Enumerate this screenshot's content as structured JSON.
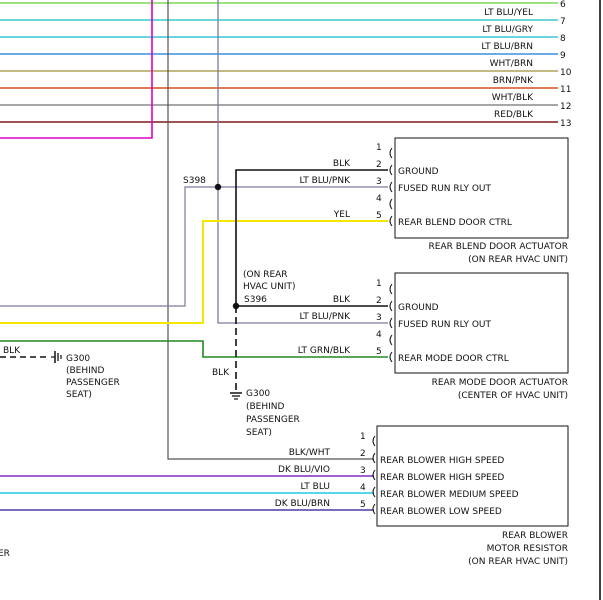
{
  "top_wires": [
    {
      "label": "LT BLU/YEL",
      "pin": "6",
      "color": "#7ed957"
    },
    {
      "label": "LT BLU/GRY",
      "pin": "7",
      "color": "#3dc9c9"
    },
    {
      "label": "LT BLU/BRN",
      "pin": "8",
      "color": "#3cc6d6"
    },
    {
      "label": "WHT/BRN",
      "pin": "9",
      "color": "#3a8fe0"
    },
    {
      "label": "BRN/PNK",
      "pin": "10",
      "color": "#b2a25a"
    },
    {
      "label": "WHT/BLK",
      "pin": "11",
      "color": "#d94f1e"
    },
    {
      "label": "RED/BLK",
      "pin": "12",
      "color": "#8a8a8a"
    },
    {
      "label": "",
      "pin": "13",
      "color": "#7a1a1a"
    }
  ],
  "splices": {
    "s398": "S398",
    "s396": "S396",
    "s396_note_line1": "(ON REAR",
    "s396_note_line2": "HVAC UNIT)"
  },
  "actuator1": {
    "pins": [
      {
        "num": "1",
        "wire": "",
        "func": ""
      },
      {
        "num": "2",
        "wire": "BLK",
        "func": "GROUND"
      },
      {
        "num": "3",
        "wire": "LT BLU/PNK",
        "func": "FUSED RUN RLY OUT"
      },
      {
        "num": "4",
        "wire": "",
        "func": ""
      },
      {
        "num": "5",
        "wire": "YEL",
        "func": "REAR BLEND DOOR CTRL"
      }
    ],
    "title": "REAR BLEND DOOR ACTUATOR",
    "subtitle": "(ON REAR HVAC UNIT)"
  },
  "actuator2": {
    "pins": [
      {
        "num": "1",
        "wire": "",
        "func": ""
      },
      {
        "num": "2",
        "wire": "BLK",
        "func": "GROUND"
      },
      {
        "num": "3",
        "wire": "LT BLU/PNK",
        "func": "FUSED RUN RLY OUT"
      },
      {
        "num": "4",
        "wire": "",
        "func": ""
      },
      {
        "num": "5",
        "wire": "LT GRN/BLK",
        "func": "REAR MODE DOOR CTRL"
      }
    ],
    "title": "REAR MODE DOOR ACTUATOR",
    "subtitle": "(CENTER OF HVAC UNIT)"
  },
  "resistor": {
    "pins": [
      {
        "num": "1",
        "wire": "",
        "func": ""
      },
      {
        "num": "2",
        "wire": "BLK/WHT",
        "func": "REAR BLOWER HIGH SPEED"
      },
      {
        "num": "3",
        "wire": "DK BLU/VIO",
        "func": "REAR BLOWER HIGH SPEED"
      },
      {
        "num": "4",
        "wire": "LT BLU",
        "func": "REAR BLOWER MEDIUM SPEED"
      },
      {
        "num": "5",
        "wire": "DK BLU/BRN",
        "func": "REAR BLOWER LOW SPEED"
      }
    ],
    "title_line1": "REAR BLOWER",
    "title_line2": "MOTOR RESISTOR",
    "title_line3": "(ON REAR HVAC UNIT)"
  },
  "ground_left": {
    "wire": "BLK",
    "name": "G300",
    "line1": "(BEHIND",
    "line2": "PASSENGER",
    "line3": "SEAT)"
  },
  "ground_center": {
    "wire": "BLK",
    "name": "G300",
    "line1": "(BEHIND",
    "line2": "PASSENGER",
    "line3": "SEAT)"
  },
  "cut_text": "ER",
  "colors": {
    "magenta": "#e000c8",
    "gray_wire": "#7a7aa0",
    "yellow": "#f5e600",
    "green": "#1f8a1f",
    "black": "#111111",
    "purple": "#7b2bbf",
    "cyan": "#22c8e8",
    "dkblu_brn": "#4c3aa0"
  }
}
